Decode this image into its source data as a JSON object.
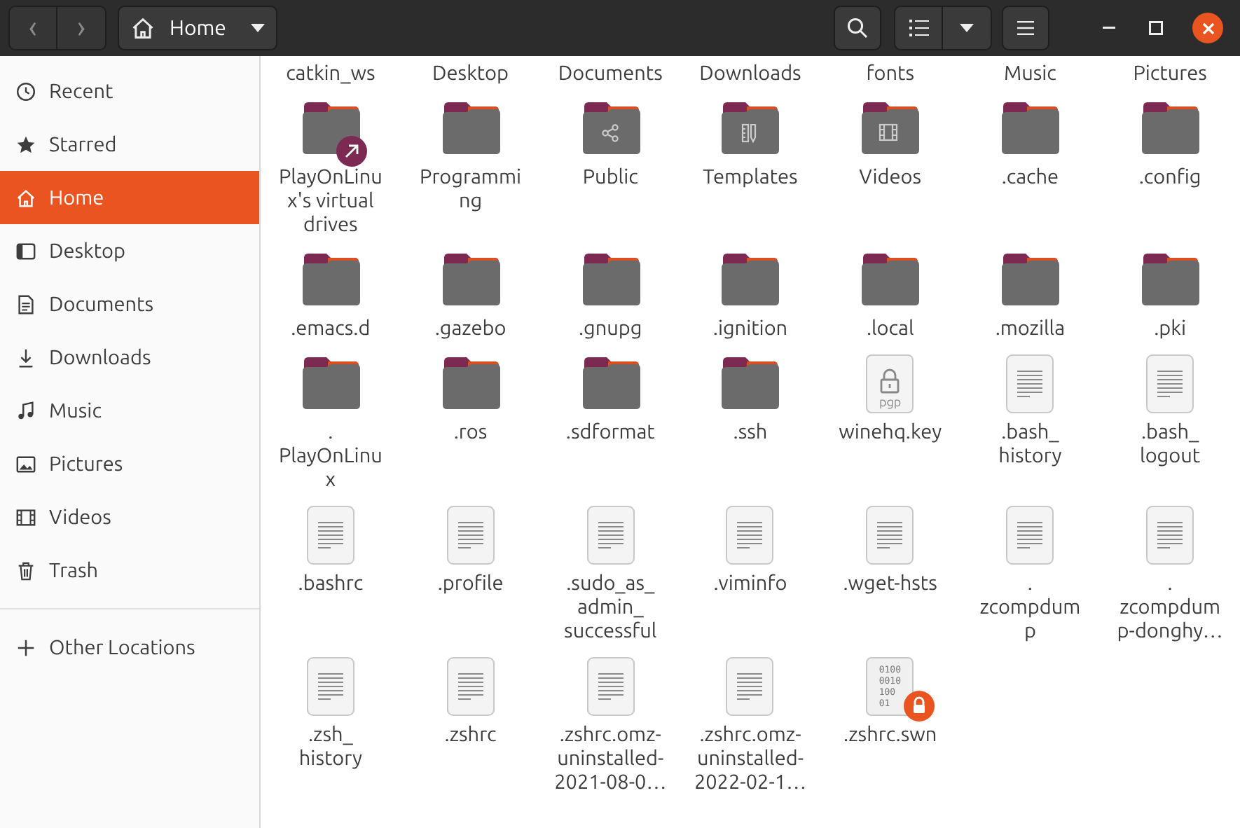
{
  "headerbar": {
    "back": "‹",
    "forward": "›",
    "path": "Home"
  },
  "sidebar": {
    "items": [
      {
        "label": "Recent",
        "kind": "clock",
        "selected": false
      },
      {
        "label": "Starred",
        "kind": "star",
        "selected": false
      },
      {
        "label": "Home",
        "kind": "home",
        "selected": true
      },
      {
        "label": "Desktop",
        "kind": "desktop",
        "selected": false
      },
      {
        "label": "Documents",
        "kind": "document",
        "selected": false
      },
      {
        "label": "Downloads",
        "kind": "download",
        "selected": false
      },
      {
        "label": "Music",
        "kind": "music",
        "selected": false
      },
      {
        "label": "Pictures",
        "kind": "picture",
        "selected": false
      },
      {
        "label": "Videos",
        "kind": "film",
        "selected": false
      },
      {
        "label": "Trash",
        "kind": "trash",
        "selected": false
      }
    ],
    "other": {
      "label": "Other Locations",
      "kind": "plus"
    }
  },
  "cut_row": [
    "catkin_ws",
    "Desktop",
    "Documents",
    "Downloads",
    "fonts",
    "Music",
    "Pictures"
  ],
  "files": [
    {
      "kind": "folder-link",
      "lines": [
        "PlayOnLinu",
        "x's virtual",
        "drives"
      ]
    },
    {
      "kind": "folder",
      "lines": [
        "Programmi",
        "ng"
      ]
    },
    {
      "kind": "folder-public",
      "lines": [
        "Public"
      ]
    },
    {
      "kind": "folder-templates",
      "lines": [
        "Templates"
      ]
    },
    {
      "kind": "folder-videos",
      "lines": [
        "Videos"
      ]
    },
    {
      "kind": "folder",
      "lines": [
        ".cache"
      ]
    },
    {
      "kind": "folder",
      "lines": [
        ".config"
      ]
    },
    {
      "kind": "folder",
      "lines": [
        ".emacs.d"
      ]
    },
    {
      "kind": "folder",
      "lines": [
        ".gazebo"
      ]
    },
    {
      "kind": "folder",
      "lines": [
        ".gnupg"
      ]
    },
    {
      "kind": "folder",
      "lines": [
        ".ignition"
      ]
    },
    {
      "kind": "folder",
      "lines": [
        ".local"
      ]
    },
    {
      "kind": "folder",
      "lines": [
        ".mozilla"
      ]
    },
    {
      "kind": "folder",
      "lines": [
        ".pki"
      ]
    },
    {
      "kind": "folder",
      "lines": [
        ".",
        "PlayOnLinu",
        "x"
      ]
    },
    {
      "kind": "folder",
      "lines": [
        ".ros"
      ]
    },
    {
      "kind": "folder",
      "lines": [
        ".sdformat"
      ]
    },
    {
      "kind": "folder",
      "lines": [
        ".ssh"
      ]
    },
    {
      "kind": "key",
      "lines": [
        "winehq.key"
      ],
      "icon_text": "pgp"
    },
    {
      "kind": "text",
      "lines": [
        ".bash_",
        "history"
      ]
    },
    {
      "kind": "text",
      "lines": [
        ".bash_",
        "logout"
      ]
    },
    {
      "kind": "text",
      "lines": [
        ".bashrc"
      ]
    },
    {
      "kind": "text",
      "lines": [
        ".profile"
      ]
    },
    {
      "kind": "text",
      "lines": [
        ".sudo_as_",
        "admin_",
        "successful"
      ]
    },
    {
      "kind": "text",
      "lines": [
        ".viminfo"
      ]
    },
    {
      "kind": "text",
      "lines": [
        ".wget-hsts"
      ]
    },
    {
      "kind": "text",
      "lines": [
        ".",
        "zcompdum",
        "p"
      ]
    },
    {
      "kind": "text",
      "lines": [
        ".",
        "zcompdum",
        "p-donghy…"
      ]
    },
    {
      "kind": "text",
      "lines": [
        ".zsh_",
        "history"
      ]
    },
    {
      "kind": "text",
      "lines": [
        ".zshrc"
      ]
    },
    {
      "kind": "text",
      "lines": [
        ".zshrc.omz-",
        "uninstalled-",
        "2021-08-0…"
      ]
    },
    {
      "kind": "text",
      "lines": [
        ".zshrc.omz-",
        "uninstalled-",
        "2022-02-1…"
      ]
    },
    {
      "kind": "binary-locked",
      "lines": [
        ".zshrc.swn"
      ],
      "icon_text": [
        "0100",
        "0010",
        "100",
        "01"
      ]
    }
  ]
}
